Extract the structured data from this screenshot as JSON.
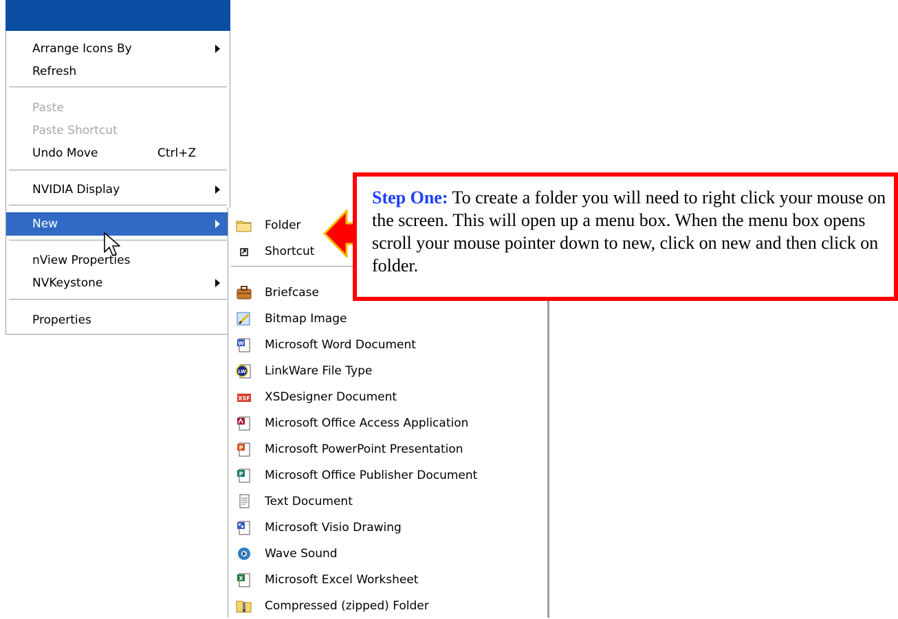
{
  "context_menu": {
    "items": [
      {
        "label": "Arrange Icons By",
        "submenu": true
      },
      {
        "label": "Refresh"
      },
      {
        "label": "Paste",
        "disabled": true
      },
      {
        "label": "Paste Shortcut",
        "disabled": true
      },
      {
        "label": "Undo Move",
        "shortcut": "Ctrl+Z"
      },
      {
        "label": "NVIDIA Display",
        "submenu": true
      },
      {
        "label": "New",
        "submenu": true,
        "highlighted": true
      },
      {
        "label": "nView Properties"
      },
      {
        "label": "NVKeystone",
        "submenu": true
      },
      {
        "label": "Properties"
      }
    ]
  },
  "new_submenu": {
    "items": [
      {
        "label": "Folder",
        "icon": "folder-icon"
      },
      {
        "label": "Shortcut",
        "icon": "shortcut-icon"
      },
      {
        "label": "Briefcase",
        "icon": "briefcase-icon"
      },
      {
        "label": "Bitmap Image",
        "icon": "bitmap-icon"
      },
      {
        "label": "Microsoft Word Document",
        "icon": "word-icon"
      },
      {
        "label": "LinkWare File Type",
        "icon": "linkware-icon"
      },
      {
        "label": "XSDesigner Document",
        "icon": "xsdesigner-icon"
      },
      {
        "label": "Microsoft Office Access Application",
        "icon": "access-icon"
      },
      {
        "label": "Microsoft PowerPoint Presentation",
        "icon": "powerpoint-icon"
      },
      {
        "label": "Microsoft Office Publisher Document",
        "icon": "publisher-icon"
      },
      {
        "label": "Text Document",
        "icon": "text-document-icon"
      },
      {
        "label": "Microsoft Visio Drawing",
        "icon": "visio-icon"
      },
      {
        "label": "Wave Sound",
        "icon": "wave-sound-icon"
      },
      {
        "label": "Microsoft Excel Worksheet",
        "icon": "excel-icon"
      },
      {
        "label": "Compressed (zipped) Folder",
        "icon": "zip-folder-icon"
      }
    ]
  },
  "callout": {
    "step_label": "Step One:",
    "text": " To create a folder you will need to right click your mouse on the screen. This will open up a menu box. When the menu box opens scroll your mouse pointer down to new, click on new and then click on folder."
  },
  "colors": {
    "menu_highlight": "#316ac5",
    "titlebar": "#0a4fa3",
    "callout_border": "#ff0000",
    "callout_arrow": "#ff0000",
    "step_label": "#1f3fff",
    "disabled_text": "#a7a6aa"
  }
}
